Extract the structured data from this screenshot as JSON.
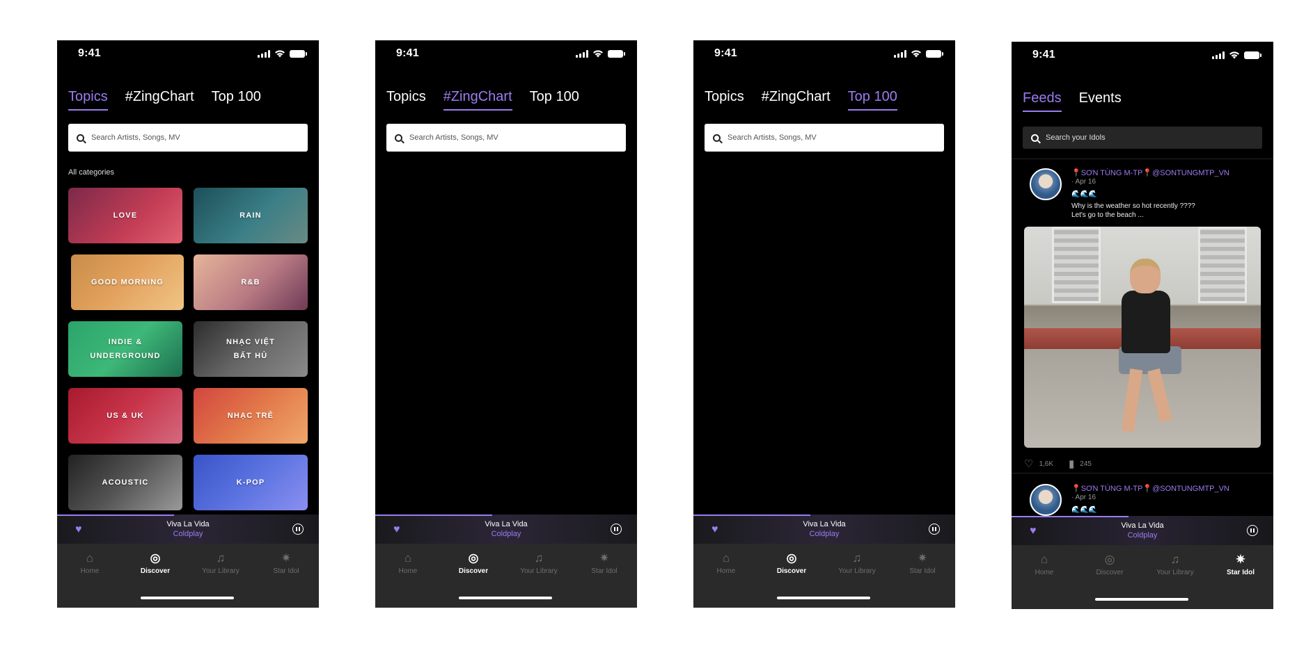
{
  "status": {
    "time": "9:41"
  },
  "discover": {
    "tabs": [
      "Topics",
      "#ZingChart",
      "Top 100"
    ],
    "search_placeholder": "Search Artists, Songs, MV",
    "categories_label": "All categories",
    "categories": [
      {
        "label": "LOVE"
      },
      {
        "label": "RAIN"
      },
      {
        "label": "GOOD MORNING"
      },
      {
        "label": "R&B"
      },
      {
        "label": "INDIE &\nUNDERGROUND"
      },
      {
        "label": "NHẠC VIỆT\nBẤT HỦ"
      },
      {
        "label": "US & UK"
      },
      {
        "label": "NHẠC TRẺ"
      },
      {
        "label": "ACOUSTIC"
      },
      {
        "label": "K-POP"
      }
    ]
  },
  "star_idol": {
    "tabs": [
      "Feeds",
      "Events"
    ],
    "search_placeholder": "Search your Idols",
    "posts": [
      {
        "name": "📍SƠN TÙNG M-TP📍@SONTUNGMTP_VN",
        "date": "· Apr 16",
        "emoji": "🌊🌊🌊",
        "text": "Why is the weather so hot recently ????\nLet's go to the beach ...",
        "likes": "1,6K",
        "comments": "245"
      },
      {
        "name": "📍SƠN TÙNG M-TP📍@SONTUNGMTP_VN",
        "date": "· Apr 16",
        "emoji": "🌊🌊🌊"
      }
    ]
  },
  "player": {
    "title": "Viva La Vida",
    "artist": "Coldplay"
  },
  "nav": [
    "Home",
    "Discover",
    "Your Library",
    "Star Idol"
  ],
  "colors": {
    "accent": "#9b7cf0",
    "background": "#000000",
    "nav_bg": "#2a2a2a"
  }
}
